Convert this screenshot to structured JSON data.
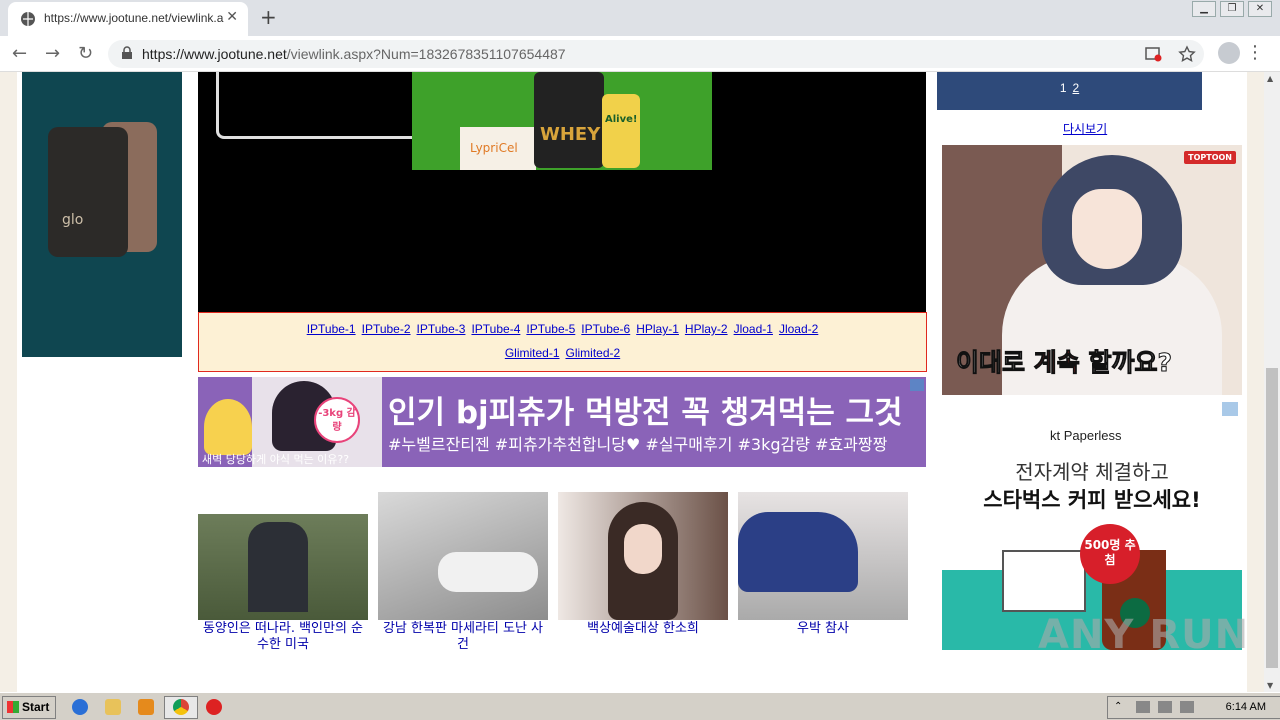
{
  "browser": {
    "tab_title": "https://www.jootune.net/viewlink.a",
    "url_host": "https://www.jootune.net",
    "url_path": "/viewlink.aspx?Num=1832678351107654487",
    "new_tab": "+",
    "close_tab": "✕"
  },
  "window_controls": {
    "minimize": "▁",
    "maximize": "❐",
    "close": "✕"
  },
  "video_ad": {
    "brand_whey": "WHEY",
    "brand_lypricel": "LypriCel",
    "brand_alive": "Alive!"
  },
  "stream_links": {
    "row1": [
      "IPTube-1",
      "IPTube-2",
      "IPTube-3",
      "IPTube-4",
      "IPTube-5",
      "IPTube-6",
      "HPlay-1",
      "HPlay-2",
      "Jload-1",
      "Jload-2"
    ],
    "row2": [
      "Glimited-1",
      "Glimited-2"
    ]
  },
  "promo": {
    "headline": "인기 bj피츄가 먹방전 꼭 챙겨먹는 그것",
    "tags": "#누벨르잔티젠 #피츄가추천합니당♥ #실구매후기 #3kg감량 #효과짱짱",
    "badge": "-3kg 감량",
    "bottom_text": "새벽 당당하게 야식 먹는 이유??"
  },
  "news": [
    {
      "caption": "동양인은 떠나라. 백인만의 순수한 미국"
    },
    {
      "caption": "강남 한복판 마세라티 도난 사건"
    },
    {
      "caption": "백상예술대상 한소희"
    },
    {
      "caption": "우박 참사"
    }
  ],
  "pager": {
    "current": "1",
    "next": "2"
  },
  "more_link": "다시보기",
  "webtoon_ad": {
    "logo": "TOPTOON",
    "slogan_a": "이대로 ",
    "slogan_b": "계속",
    "slogan_c": " 할까요?"
  },
  "kt_ad": {
    "brand": "kt Paperless",
    "line1": "전자계약 체결하고",
    "line2": "스타벅스 커피 받으세요!",
    "badge": "500명 추첨"
  },
  "left_ad": {
    "brand": "glo"
  },
  "watermark": "ANY RUN",
  "taskbar": {
    "start": "Start",
    "time": "6:14 AM"
  },
  "colors": {
    "pager_bg": "#2e4a7a",
    "link": "#0000cc",
    "links_border": "#e0291e",
    "promo_bg": "#8a63b8"
  }
}
